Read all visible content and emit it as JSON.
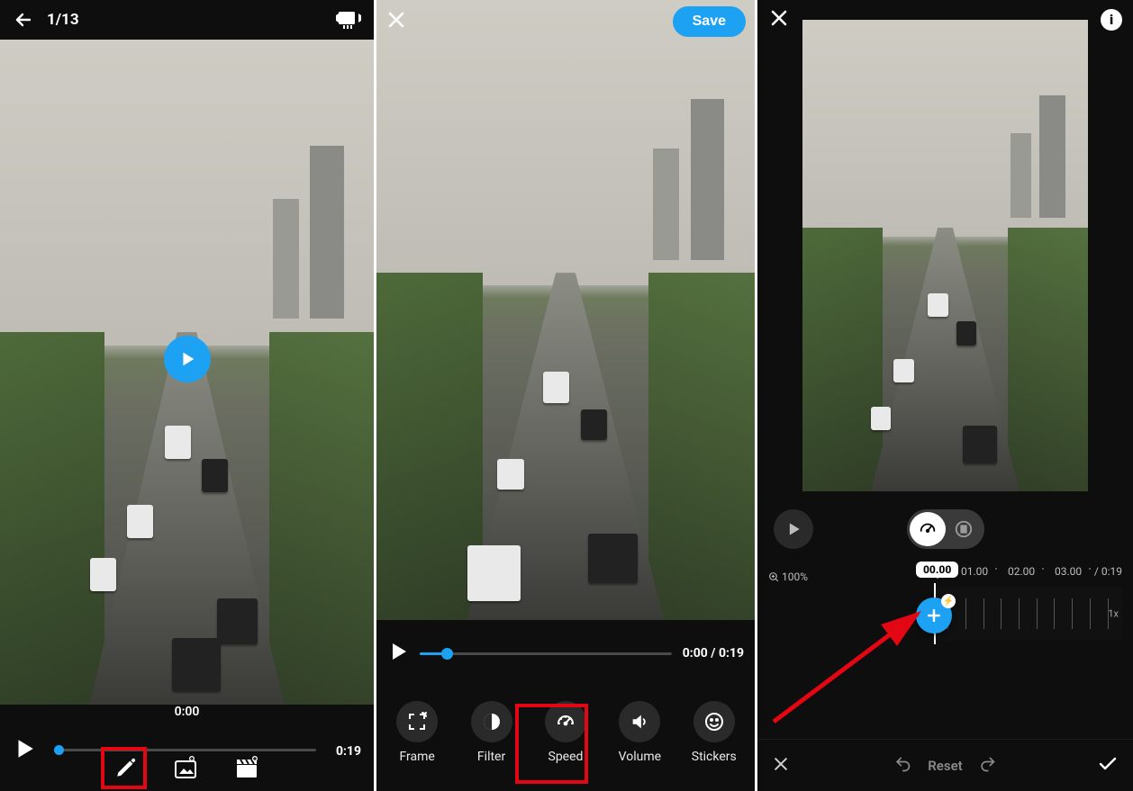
{
  "panel1": {
    "counter": "1/13",
    "time_current": "0:00",
    "duration": "0:19"
  },
  "panel2": {
    "save_label": "Save",
    "time_display": "0:00 / 0:19",
    "tools": {
      "frame": "Frame",
      "filter": "Filter",
      "speed": "Speed",
      "volume": "Volume",
      "stickers": "Stickers"
    }
  },
  "panel3": {
    "zoom": "100%",
    "playhead_time": "00.00",
    "ruler_ticks": {
      "t1": "01.00",
      "t2": "02.00",
      "t3": "03.00"
    },
    "total": "/ 0:19",
    "speed_marker": "1x",
    "reset_label": "Reset"
  }
}
